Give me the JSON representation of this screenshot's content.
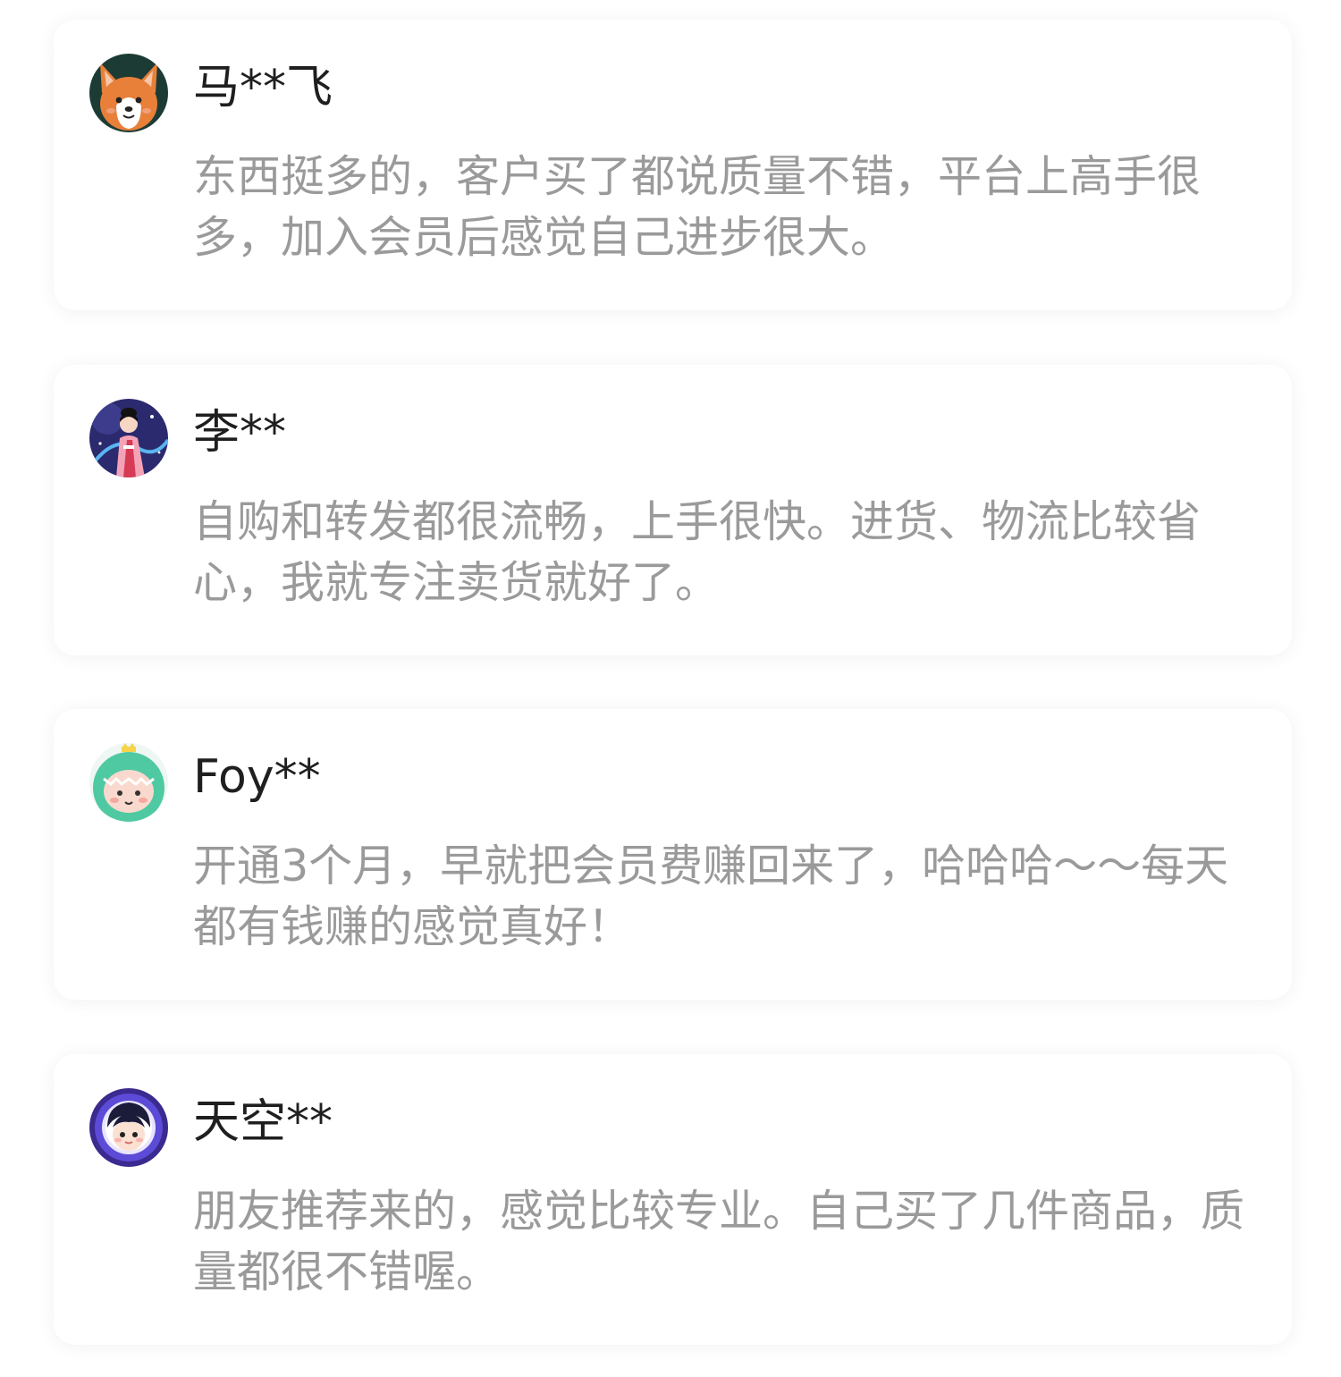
{
  "reviews": [
    {
      "avatar_icon": "corgi-avatar-icon",
      "username": "马**飞",
      "comment": "东西挺多的，客户买了都说质量不错，平台上高手很多，加入会员后感觉自己进步很大。"
    },
    {
      "avatar_icon": "hanfu-girl-avatar-icon",
      "username": "李**",
      "comment": "自购和转发都很流畅，上手很快。进货、物流比较省心，我就专注卖货就好了。"
    },
    {
      "avatar_icon": "dino-costume-avatar-icon",
      "username": "Foy**",
      "comment": "开通3个月，早就把会员费赚回来了，哈哈哈～～每天都有钱赚的感觉真好！"
    },
    {
      "avatar_icon": "astronaut-boy-avatar-icon",
      "username": "天空**",
      "comment": "朋友推荐来的，感觉比较专业。自己买了几件商品，质量都很不错喔。"
    }
  ],
  "colors": {
    "username": "#1f1f1f",
    "comment": "#9a9a9a",
    "card_bg": "#ffffff"
  }
}
